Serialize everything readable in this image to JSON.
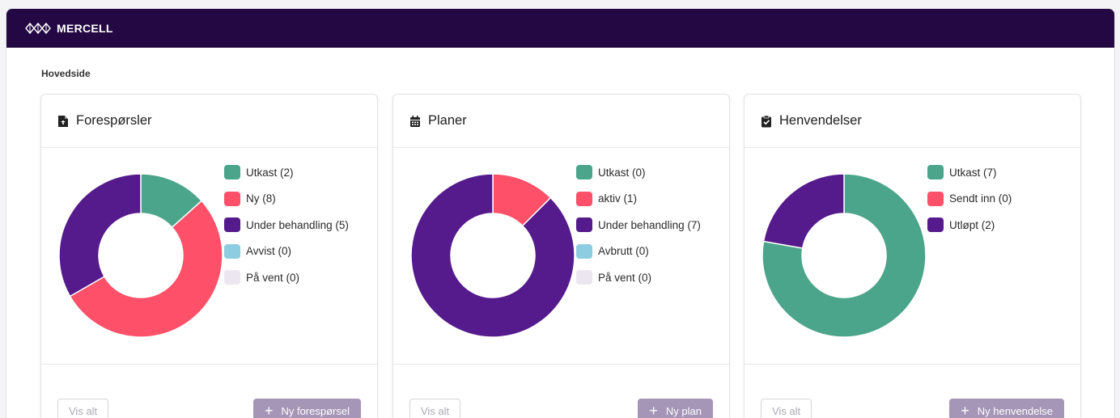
{
  "brand": {
    "name": "MERCELL"
  },
  "breadcrumb": "Hovedside",
  "colors": {
    "topbar": "#230843",
    "green": "#4ba58a",
    "red": "#fe5068",
    "purple": "#551a8b",
    "lightblue": "#8ccde2",
    "lavender": "#ece6f0",
    "button_primary": "#a595b7"
  },
  "cards": [
    {
      "title": "Forespørsler",
      "icon": "file-invoice-icon",
      "legend": [
        {
          "label": "Utkast (2)",
          "value": 2,
          "color": "#4ba58a"
        },
        {
          "label": "Ny (8)",
          "value": 8,
          "color": "#fe5068"
        },
        {
          "label": "Under behandling (5)",
          "value": 5,
          "color": "#551a8b"
        },
        {
          "label": "Avvist (0)",
          "value": 0,
          "color": "#8ccde2"
        },
        {
          "label": "På vent (0)",
          "value": 0,
          "color": "#ece6f0"
        }
      ],
      "view_all": "Vis alt",
      "new_label": "Ny forespørsel"
    },
    {
      "title": "Planer",
      "icon": "calendar-icon",
      "legend": [
        {
          "label": "Utkast (0)",
          "value": 0,
          "color": "#4ba58a"
        },
        {
          "label": "aktiv (1)",
          "value": 1,
          "color": "#fe5068"
        },
        {
          "label": "Under behandling (7)",
          "value": 7,
          "color": "#551a8b"
        },
        {
          "label": "Avbrutt (0)",
          "value": 0,
          "color": "#8ccde2"
        },
        {
          "label": "På vent (0)",
          "value": 0,
          "color": "#ece6f0"
        }
      ],
      "view_all": "Vis alt",
      "new_label": "Ny plan"
    },
    {
      "title": "Henvendelser",
      "icon": "clipboard-check-icon",
      "legend": [
        {
          "label": "Utkast (7)",
          "value": 7,
          "color": "#4ba58a"
        },
        {
          "label": "Sendt inn (0)",
          "value": 0,
          "color": "#fe5068"
        },
        {
          "label": "Utløpt (2)",
          "value": 2,
          "color": "#551a8b"
        }
      ],
      "view_all": "Vis alt",
      "new_label": "Ny henvendelse"
    }
  ]
}
